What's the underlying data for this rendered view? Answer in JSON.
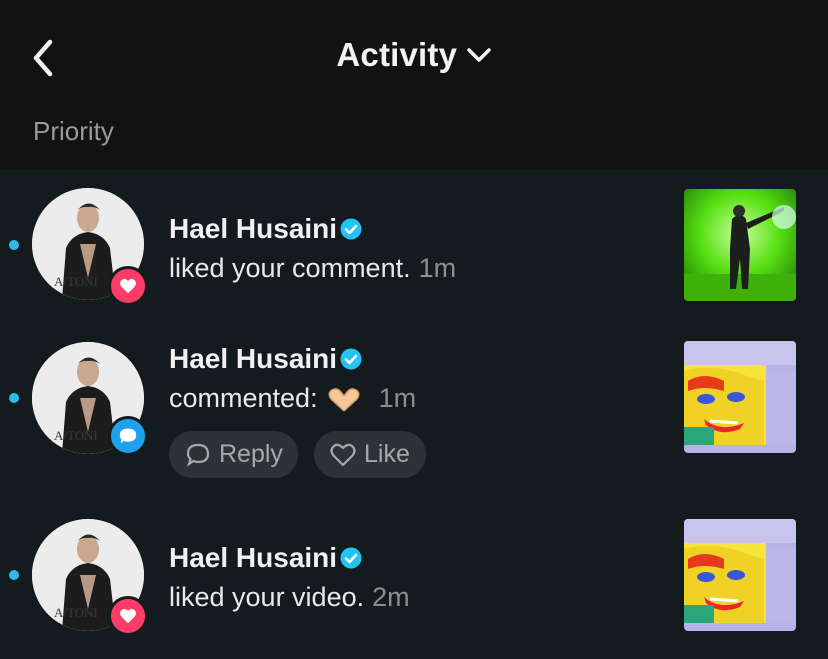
{
  "header": {
    "title": "Activity",
    "back_icon": "chevron-left-icon",
    "dropdown_icon": "chevron-down-icon"
  },
  "section": {
    "label": "Priority"
  },
  "colors": {
    "background": "#121212",
    "list_background": "#141b1e",
    "unread_dot": "#2bbde8",
    "like_badge": "#ff3b67",
    "comment_badge": "#1fa2ee",
    "verified": "#20c5f5"
  },
  "notifications": [
    {
      "user": "Hael Husaini",
      "verified": true,
      "action": "liked your comment.",
      "time": "1m",
      "badge_icon": "heart-icon",
      "unread": true,
      "thumb": "green-stage-performer"
    },
    {
      "user": "Hael Husaini",
      "verified": true,
      "action": "commented:",
      "emoji": "heart-hands-emoji",
      "time": "1m",
      "badge_icon": "comment-icon",
      "unread": true,
      "thumb": "pop-art-face",
      "buttons": {
        "reply": "Reply",
        "like": "Like"
      }
    },
    {
      "user": "Hael Husaini",
      "verified": true,
      "action": "liked your video.",
      "time": "2m",
      "badge_icon": "heart-icon",
      "unread": true,
      "thumb": "pop-art-face"
    }
  ]
}
